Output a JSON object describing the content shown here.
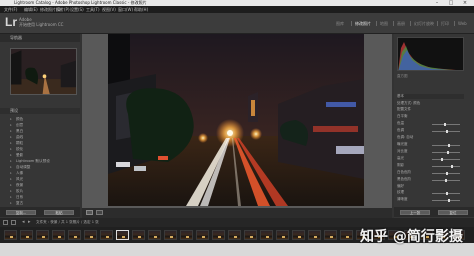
{
  "window": {
    "title": "Lightroom Catalog - Adobe Photoshop Lightroom Classic - 修改照片"
  },
  "menu": [
    "文件(F)",
    "编辑(E)",
    "修改照片(D)",
    "照片(P)",
    "设置(S)",
    "工具(T)",
    "视图(V)",
    "窗口(W)",
    "帮助(H)"
  ],
  "identity": {
    "logo": "Lr",
    "line1": "Adobe",
    "line2": "开始使用 Lightroom CC"
  },
  "modules": [
    "图库",
    "修改照片",
    "地图",
    "画册",
    "幻灯片放映",
    "打印",
    "Web"
  ],
  "left": {
    "navigator_label": "导航器",
    "presets_label": "预设",
    "presets": [
      "颜色",
      "创意",
      "黑白",
      "曲线",
      "颗粒",
      "锐化",
      "晕影",
      "Lightroom 默认预设",
      "自动调整",
      "人像",
      "风光",
      "夜景",
      "胶片",
      "日系",
      "复古",
      "城市",
      "人像肤色",
      "HDR",
      "用户预设",
      "导入预设",
      "导出预设"
    ],
    "copy_label": "复制...",
    "paste_label": "粘贴"
  },
  "right": {
    "histogram_label": "直方图",
    "basic_label": "基本",
    "rows": [
      "处理方式: 颜色",
      "配置文件",
      "白平衡",
      "色温",
      "色调",
      "色调: 自动",
      "曝光度",
      "对比度",
      "高光",
      "阴影",
      "白色色阶",
      "黑色色阶",
      "偏好",
      "纹理",
      "清晰度",
      "去朦胧",
      "鲜艳度",
      "饱和度"
    ],
    "prev_label": "上一张",
    "reset_label": "复位"
  },
  "filmstrip": {
    "path": "文件夹 : 夜景 / 共 1 张照片 / 选定 1 张"
  },
  "watermark": "知乎 @简行影摄"
}
